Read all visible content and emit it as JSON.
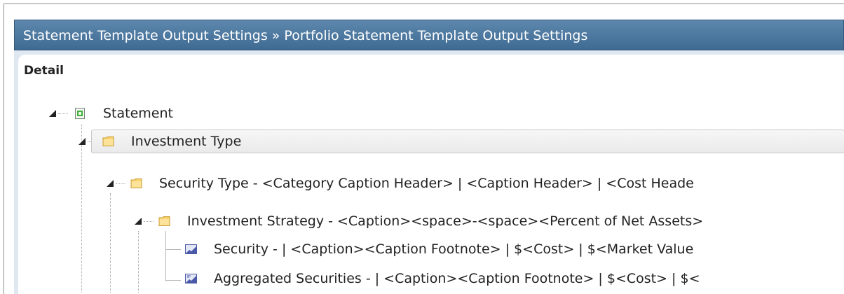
{
  "titlebar": {
    "text": "Statement Template Output Settings » Portfolio Statement Template Output Settings"
  },
  "detail": {
    "label": "Detail"
  },
  "tree": {
    "root": {
      "label": "Statement",
      "icon": "statement-icon",
      "expanded": true
    },
    "investment_type": {
      "label": "Investment Type",
      "icon": "folder-icon",
      "expanded": true,
      "selected": true
    },
    "security_type": {
      "label": "Security Type - <Category Caption Header> | <Caption Header> | <Cost Heade",
      "icon": "folder-icon",
      "expanded": true
    },
    "investment_strategy": {
      "label": "Investment Strategy - <Caption><space>-<space><Percent of Net Assets>",
      "icon": "folder-icon",
      "expanded": true
    },
    "security": {
      "label": "Security -  | <Caption><Caption Footnote> | $<Cost> | $<Market Value",
      "icon": "chart-icon"
    },
    "aggregated_securities": {
      "label": "Aggregated Securities -  | <Caption><Caption Footnote> | $<Cost> | $<",
      "icon": "aggregate-chart-icon"
    }
  },
  "colors": {
    "titlebar_top": "#5d87ad",
    "titlebar_bottom": "#3f6a92",
    "panel_bg": "#dfe8f1",
    "folder": "#f6cf6b"
  }
}
